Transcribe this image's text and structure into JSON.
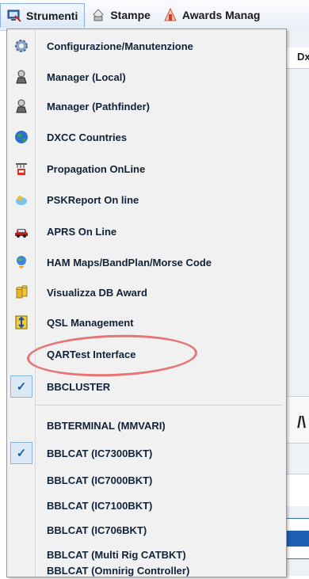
{
  "menubar": {
    "items": [
      {
        "label": "Strumenti",
        "icon": "monitor-tools-icon",
        "active": true
      },
      {
        "label": "Stampe",
        "icon": "printer-icon",
        "active": false
      },
      {
        "label": "Awards Manag",
        "icon": "award-icon",
        "active": false
      }
    ]
  },
  "background_window": {
    "text_top": "Dx",
    "text_mid": "/\\"
  },
  "dropdown": {
    "items": [
      {
        "label": "Configurazione/Manutenzione",
        "icon": "gear-icon"
      },
      {
        "label": "Manager (Local)",
        "icon": "manager-icon"
      },
      {
        "label": "Manager (Pathfinder)",
        "icon": "manager-icon"
      },
      {
        "label": "DXCC Countries",
        "icon": "globe-icon"
      },
      {
        "label": "Propagation OnLine",
        "icon": "antenna-icon"
      },
      {
        "label": "PSKReport On line",
        "icon": "pskreport-icon"
      },
      {
        "label": "APRS On Line",
        "icon": "car-icon"
      },
      {
        "label": "HAM Maps/BandPlan/Morse Code",
        "icon": "map-pin-icon"
      },
      {
        "label": "Visualizza DB Award",
        "icon": "database-icon"
      },
      {
        "label": "QSL Management",
        "icon": "qsl-icon"
      },
      {
        "label": "QARTest Interface",
        "icon": "",
        "highlighted": true
      },
      {
        "label": "BBCLUSTER",
        "checked": true
      },
      {
        "label": "BBTERMINAL (MMVARI)",
        "checked": false
      },
      {
        "label": "BBLCAT (IC7300BKT)",
        "checked": true
      },
      {
        "label": "BBLCAT (IC7000BKT)",
        "checked": false
      },
      {
        "label": "BBLCAT (IC7100BKT)",
        "checked": false
      },
      {
        "label": "BBLCAT (IC706BKT)",
        "checked": false
      },
      {
        "label": "BBLCAT (Multi Rig CATBKT)",
        "checked": false
      },
      {
        "label": "BBLCAT (Omnirig Controller)",
        "checked": false
      }
    ],
    "check_glyph": "✓"
  },
  "colors": {
    "menu_background": "#f1f1f1",
    "checked_box": "#dbe9f6",
    "highlight_ellipse": "#e46868"
  }
}
